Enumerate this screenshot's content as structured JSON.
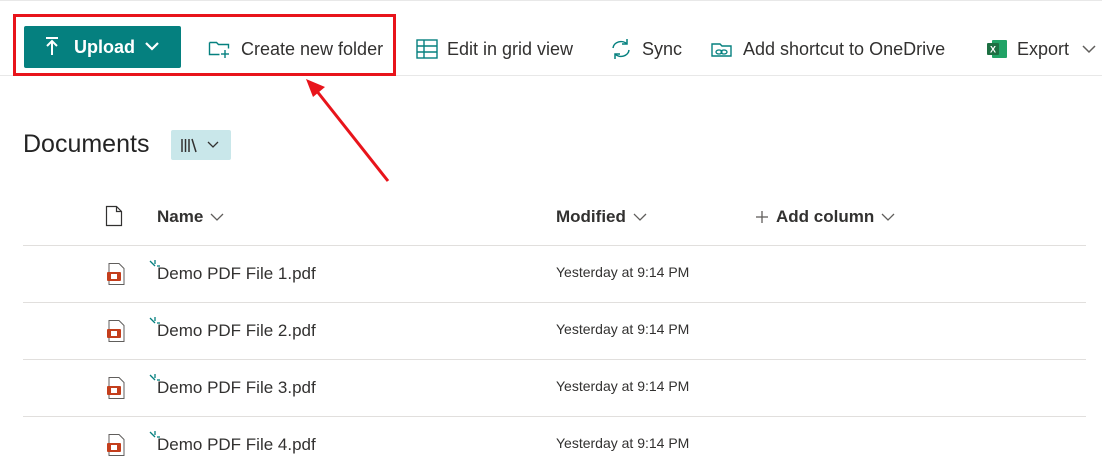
{
  "toolbar": {
    "upload_label": "Upload",
    "create_folder_label": "Create new folder",
    "edit_grid_label": "Edit in grid view",
    "sync_label": "Sync",
    "add_shortcut_label": "Add shortcut to OneDrive",
    "export_label": "Export"
  },
  "library": {
    "title": "Documents",
    "view_icon": "library-view-icon"
  },
  "columns": {
    "name": "Name",
    "modified": "Modified",
    "add_column": "Add column"
  },
  "files": [
    {
      "name": "Demo PDF File 1.pdf",
      "modified": "Yesterday at 9:14 PM"
    },
    {
      "name": "Demo PDF File 2.pdf",
      "modified": "Yesterday at 9:14 PM"
    },
    {
      "name": "Demo PDF File 3.pdf",
      "modified": "Yesterday at 9:14 PM"
    },
    {
      "name": "Demo PDF File 4.pdf",
      "modified": "Yesterday at 9:14 PM"
    }
  ],
  "colors": {
    "accent": "#05807f",
    "highlight": "#e8141b",
    "pdf_icon": "#c43e1c",
    "excel": "#1d6f42"
  }
}
